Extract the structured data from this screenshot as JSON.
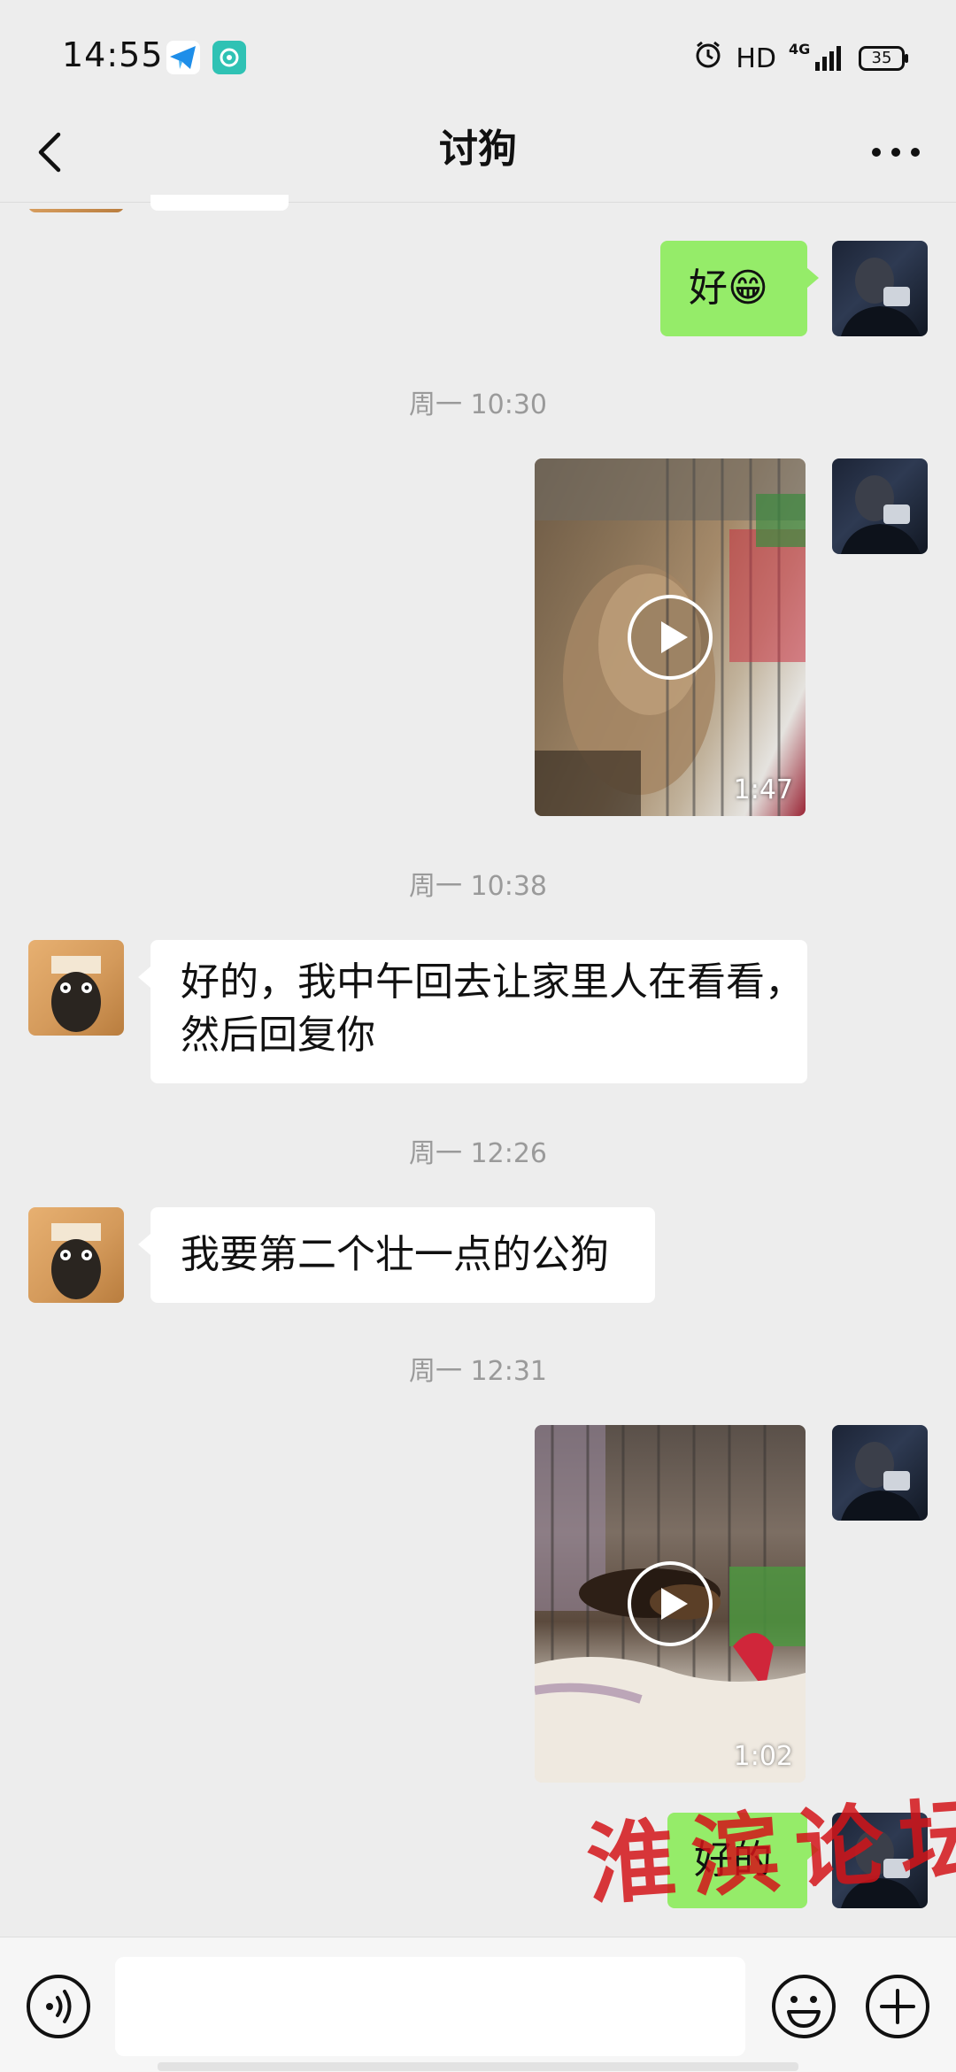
{
  "status_bar": {
    "time": "14:55",
    "hd": "HD",
    "network": "4G",
    "battery": "35",
    "icons": [
      "telegram-icon",
      "app-icon",
      "alarm-icon",
      "signal-icon",
      "battery-icon"
    ]
  },
  "navbar": {
    "title": "讨狗",
    "back_icon": "chevron-left-icon",
    "more_icon": "more-icon"
  },
  "messages": [
    {
      "type": "text",
      "side": "mine",
      "text": "好😁"
    },
    {
      "type": "timestamp",
      "text": "周一 10:30"
    },
    {
      "type": "video",
      "side": "mine",
      "duration": "1:47"
    },
    {
      "type": "timestamp",
      "text": "周一 10:38"
    },
    {
      "type": "text",
      "side": "other",
      "line1": "好的，我中午回去让家里人在看看，",
      "line2": "然后回复你"
    },
    {
      "type": "timestamp",
      "text": "周一 12:26"
    },
    {
      "type": "text",
      "side": "other",
      "text": "我要第二个壮一点的公狗"
    },
    {
      "type": "timestamp",
      "text": "周一 12:31"
    },
    {
      "type": "video",
      "side": "mine",
      "duration": "1:02"
    },
    {
      "type": "text",
      "side": "mine",
      "text": "好的"
    }
  ],
  "watermark": "淮滨论坛",
  "input_bar": {
    "placeholder": "",
    "icons": [
      "voice-icon",
      "emoji-icon",
      "plus-icon"
    ]
  },
  "colors": {
    "background": "#ededed",
    "my_bubble": "#95ec69",
    "other_bubble": "#ffffff",
    "timestamp": "#9a9a9a",
    "watermark": "#d21419"
  }
}
